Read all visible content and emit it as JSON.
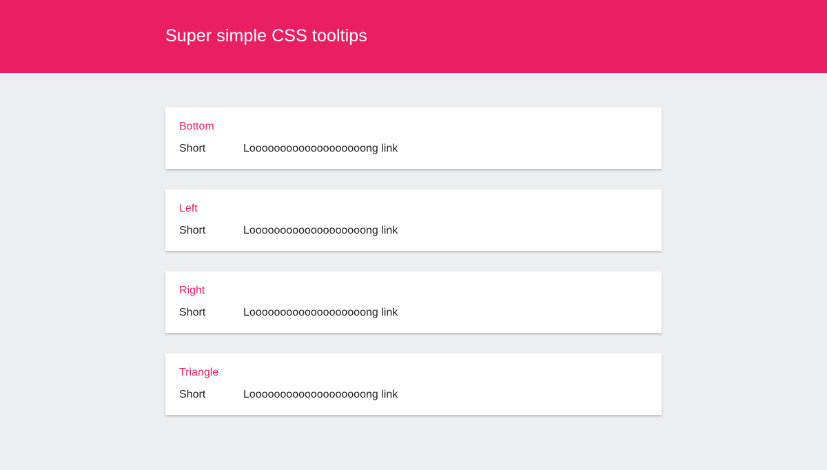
{
  "header": {
    "title": "Super simple CSS tooltips"
  },
  "cards": [
    {
      "title": "Bottom",
      "short_link": "Short",
      "long_link": "Looooooooooooooooooong link"
    },
    {
      "title": "Left",
      "short_link": "Short",
      "long_link": "Looooooooooooooooooong link"
    },
    {
      "title": "Right",
      "short_link": "Short",
      "long_link": "Looooooooooooooooooong link"
    },
    {
      "title": "Triangle",
      "short_link": "Short",
      "long_link": "Looooooooooooooooooong link"
    }
  ],
  "colors": {
    "accent": "#e91e63",
    "background": "#eceff1",
    "card": "#ffffff",
    "text": "#212121"
  }
}
